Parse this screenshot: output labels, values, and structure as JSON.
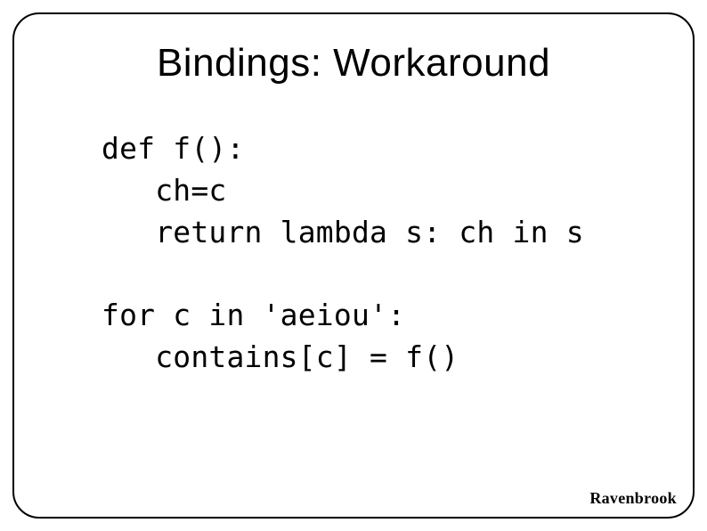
{
  "slide": {
    "title": "Bindings: Workaround",
    "code": "def f():\n   ch=c\n   return lambda s: ch in s\n\nfor c in 'aeiou':\n   contains[c] = f()",
    "footer": "Ravenbrook"
  }
}
